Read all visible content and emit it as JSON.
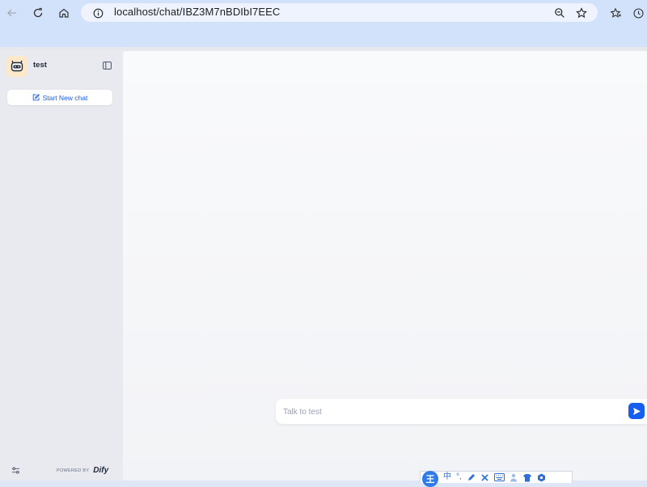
{
  "browser": {
    "url": "localhost/chat/IBZ3M7nBDIbI7EEC"
  },
  "sidebar": {
    "app_name": "test",
    "new_chat_label": "Start New chat",
    "powered_by_label": "POWERED BY",
    "brand": "Dify"
  },
  "chat": {
    "input_placeholder": "Talk to test"
  },
  "ime": {
    "mode_char": "王",
    "lang_char": "中"
  },
  "colors": {
    "accent": "#155eef",
    "avatar_bg": "#fde9c9",
    "sidebar_bg": "#e9eaef"
  }
}
